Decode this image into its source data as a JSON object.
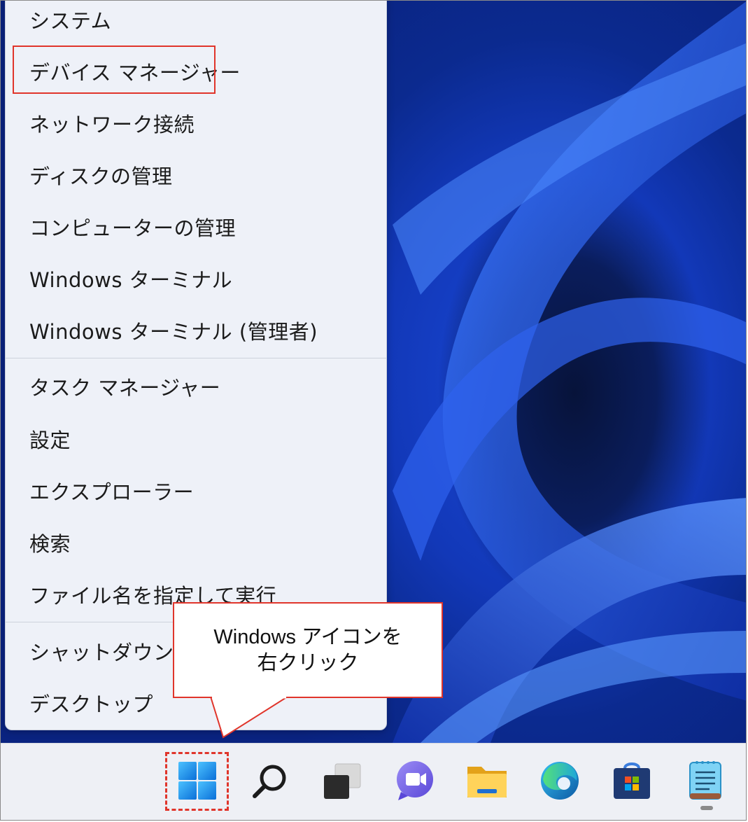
{
  "menu": {
    "items": [
      {
        "id": "system",
        "label": "システム"
      },
      {
        "id": "device-manager",
        "label": "デバイス マネージャー"
      },
      {
        "id": "network-connections",
        "label": "ネットワーク接続"
      },
      {
        "id": "disk-management",
        "label": "ディスクの管理"
      },
      {
        "id": "computer-management",
        "label": "コンピューターの管理"
      },
      {
        "id": "windows-terminal",
        "label": "Windows ターミナル"
      },
      {
        "id": "windows-terminal-admin",
        "label": "Windows ターミナル (管理者)"
      },
      {
        "id": "task-manager",
        "label": "タスク マネージャー"
      },
      {
        "id": "settings",
        "label": "設定"
      },
      {
        "id": "explorer",
        "label": "エクスプローラー"
      },
      {
        "id": "search",
        "label": "検索"
      },
      {
        "id": "run",
        "label": "ファイル名を指定して実行"
      },
      {
        "id": "shutdown",
        "label": "シャットダウンまたはサインアウト"
      },
      {
        "id": "desktop",
        "label": "デスクトップ"
      }
    ]
  },
  "callout": {
    "line1": "Windows アイコンを",
    "line2": "右クリック"
  },
  "taskbar": {
    "icons": [
      "windows-start-icon",
      "search-icon",
      "task-view-icon",
      "chat-icon",
      "file-explorer-icon",
      "edge-icon",
      "store-icon",
      "notepad-icon"
    ]
  },
  "colors": {
    "accent_red": "#e0352b",
    "wallpaper_blue": "#1a49d8",
    "menu_bg": "#eef1f8"
  }
}
